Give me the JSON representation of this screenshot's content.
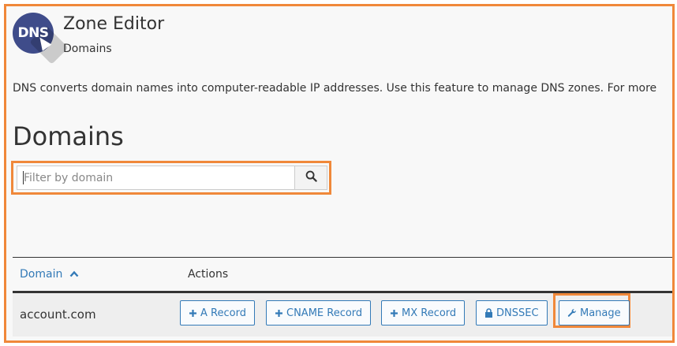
{
  "header": {
    "logo_text": "DNS",
    "title": "Zone Editor",
    "breadcrumb": "Domains"
  },
  "description": "DNS converts domain names into computer-readable IP addresses. Use this feature to manage DNS zones. For more",
  "section_title": "Domains",
  "filter": {
    "placeholder": "Filter by domain",
    "value": ""
  },
  "table": {
    "columns": [
      "Domain",
      "Actions"
    ],
    "rows": [
      {
        "domain": "account.com",
        "actions": [
          "A Record",
          "CNAME Record",
          "MX Record",
          "DNSSEC",
          "Manage"
        ]
      }
    ]
  },
  "icons": {
    "search": "search-icon",
    "sort": "chevron-up-icon",
    "add": "plus-icon",
    "lock": "lock-icon",
    "wrench": "wrench-icon"
  },
  "colors": {
    "highlight": "#f0883a",
    "link": "#337ab7",
    "logo_bg": "#3f4c8a"
  }
}
